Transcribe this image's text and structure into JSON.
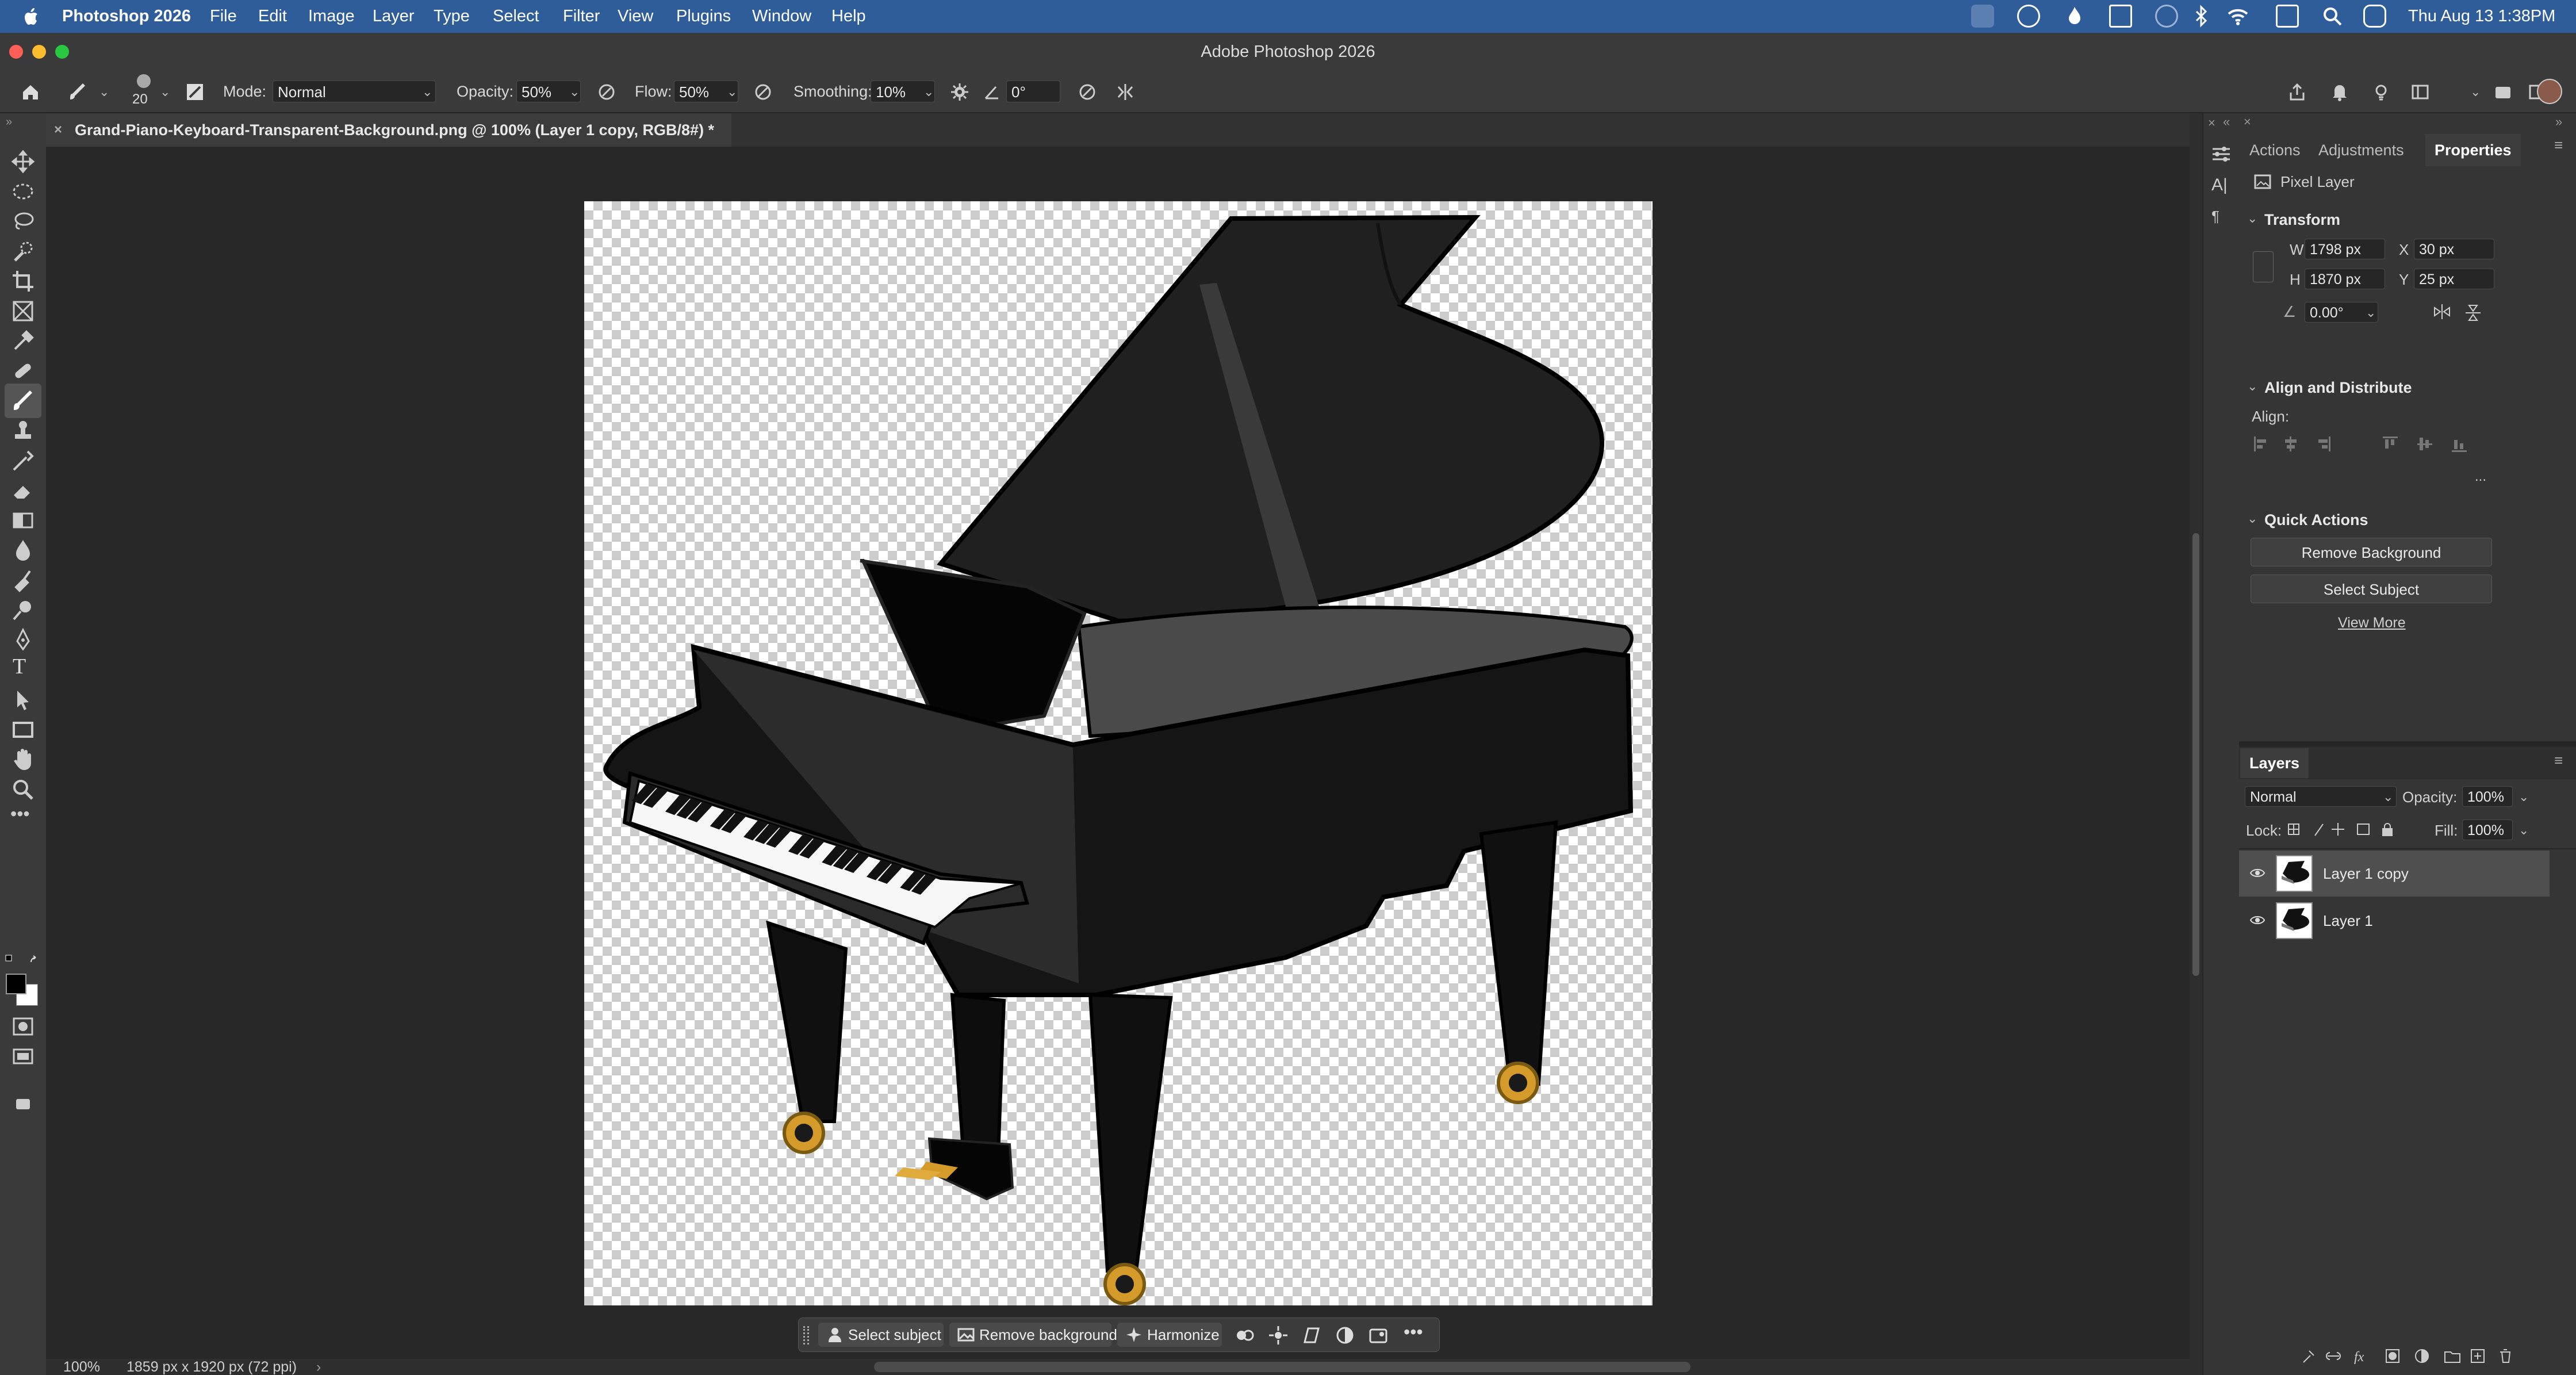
{
  "menubar": {
    "app_name": "Photoshop 2026",
    "items": [
      "File",
      "Edit",
      "Image",
      "Layer",
      "Type",
      "Select",
      "Filter",
      "View",
      "Plugins",
      "Window",
      "Help"
    ],
    "clock": "Thu Aug 13  1:38PM"
  },
  "window": {
    "title": "Adobe Photoshop 2026"
  },
  "options_bar": {
    "brush_size": "20",
    "mode_label": "Mode:",
    "mode_value": "Normal",
    "opacity_label": "Opacity:",
    "opacity_value": "50%",
    "flow_label": "Flow:",
    "flow_value": "50%",
    "smoothing_label": "Smoothing:",
    "smoothing_value": "10%",
    "angle_value": "0°"
  },
  "document": {
    "tab_title": "Grand-Piano-Keyboard-Transparent-Background.png @ 100% (Layer 1 copy, RGB/8#) *",
    "close_glyph": "×"
  },
  "taskbar": {
    "select_subject": "Select subject",
    "remove_background": "Remove background",
    "harmonize": "Harmonize"
  },
  "status": {
    "zoom": "100%",
    "doc_size": "1859 px x 1920 px (72 ppi)"
  },
  "properties_panel": {
    "tabs": [
      "Actions",
      "Adjustments",
      "Properties"
    ],
    "active_tab": "Properties",
    "layer_kind": "Pixel Layer",
    "transform": {
      "title": "Transform",
      "w_label": "W",
      "w_value": "1798 px",
      "h_label": "H",
      "h_value": "1870 px",
      "x_label": "X",
      "x_value": "30 px",
      "y_label": "Y",
      "y_value": "25 px",
      "angle_value": "0.00°"
    },
    "align": {
      "title": "Align and Distribute",
      "label": "Align:",
      "more": "..."
    },
    "quick_actions": {
      "title": "Quick Actions",
      "remove_background": "Remove Background",
      "select_subject": "Select Subject",
      "view_more": "View More"
    }
  },
  "layers_panel": {
    "title": "Layers",
    "blend_mode": "Normal",
    "opacity_label": "Opacity:",
    "opacity_value": "100%",
    "lock_label": "Lock:",
    "fill_label": "Fill:",
    "fill_value": "100%",
    "layers": [
      {
        "name": "Layer 1 copy",
        "selected": true,
        "visible": true
      },
      {
        "name": "Layer 1",
        "selected": false,
        "visible": true
      }
    ]
  },
  "colors": {
    "menubar": "#2f5d9a",
    "panel": "#353535",
    "canvas_bg": "#282828",
    "piano_body": "#1b1b1b",
    "piano_gold": "#d49a2a"
  }
}
